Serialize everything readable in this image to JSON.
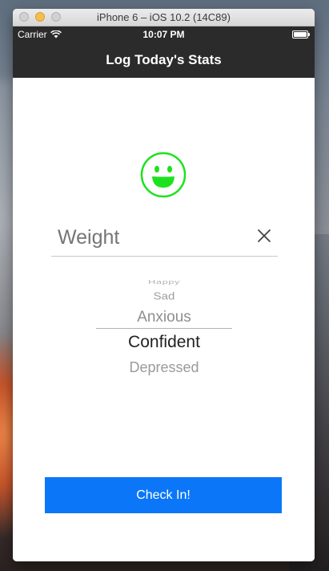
{
  "window": {
    "title": "iPhone 6 – iOS 10.2 (14C89)"
  },
  "status_bar": {
    "carrier": "Carrier",
    "time": "10:07 PM"
  },
  "nav": {
    "title": "Log Today's Stats"
  },
  "mood_icon": "smiley-face-icon",
  "weight_field": {
    "placeholder": "Weight",
    "value": ""
  },
  "mood_picker": {
    "visible_items": [
      "Happy",
      "Sad",
      "Anxious",
      "Confident",
      "Depressed"
    ],
    "selected": "Confident"
  },
  "checkin_button": {
    "label": "Check In!"
  },
  "colors": {
    "nav_background": "#2b2b2b",
    "accent_button": "#0b77f8",
    "mood_icon": "#1de21d"
  }
}
